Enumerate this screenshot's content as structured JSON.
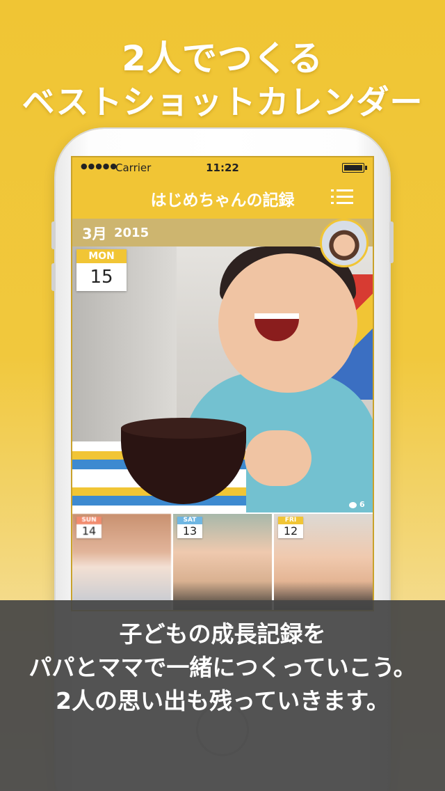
{
  "headline": {
    "line1": "2人でつくる",
    "line2": "ベストショットカレンダー"
  },
  "status_bar": {
    "signal": "●●●●●",
    "carrier": "Carrier",
    "time": "11:22"
  },
  "nav": {
    "title": "はじめちゃんの記録",
    "menu_icon": "list-menu-icon"
  },
  "month_header": {
    "month": "3月",
    "year": "2015"
  },
  "main_entry": {
    "dow": "MON",
    "day": "15",
    "comments": "6"
  },
  "thumbnails": [
    {
      "dow": "SUN",
      "day": "14",
      "dow_color": "#f28b6e"
    },
    {
      "dow": "SAT",
      "day": "13",
      "dow_color": "#6fb6e2"
    },
    {
      "dow": "FRI",
      "day": "12",
      "dow_color": "#f1c535"
    }
  ],
  "caption": {
    "line1": "子どもの成長記録を",
    "line2": "パパとママで一緒につくっていこう。",
    "line3": "2人の思い出も残っていきます。"
  },
  "colors": {
    "accent": "#f1c535",
    "month_bar": "#cdb56f",
    "caption_bg": "#464646"
  }
}
